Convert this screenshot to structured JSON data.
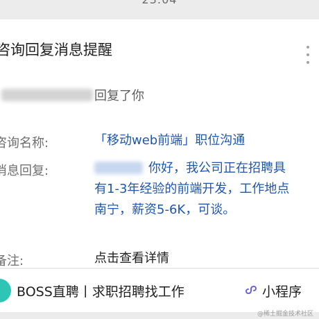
{
  "status_bar": {
    "time": "23:04"
  },
  "card": {
    "title": "咨询回复消息提醒",
    "reply_text": "回复了你",
    "position_label": "咨询名称:",
    "position_value": "「移动web前端」职位沟通",
    "message_label": "消息回复:",
    "message_lines": [
      "你好，我公司正在招聘具",
      "有1-3年经验的前端开发，工作地点",
      "南宁，薪资5-6K，可谈。"
    ],
    "note_label": "备注:",
    "note_value": "点击查看详情"
  },
  "bottom_bar": {
    "logo_text": "BOSS直聘",
    "brand": "BOSS直聘丨求职招聘找工作",
    "mini_program_label": "小程序"
  },
  "watermark": "@稀土掘金技术社区",
  "icons": {
    "more": "more-vertical-icon",
    "mini_program": "mini-program-icon"
  },
  "colors": {
    "link_blue": "#1f57b0",
    "logo_teal": "#2fc5b5",
    "mini_program_purple": "#6a64d8"
  }
}
